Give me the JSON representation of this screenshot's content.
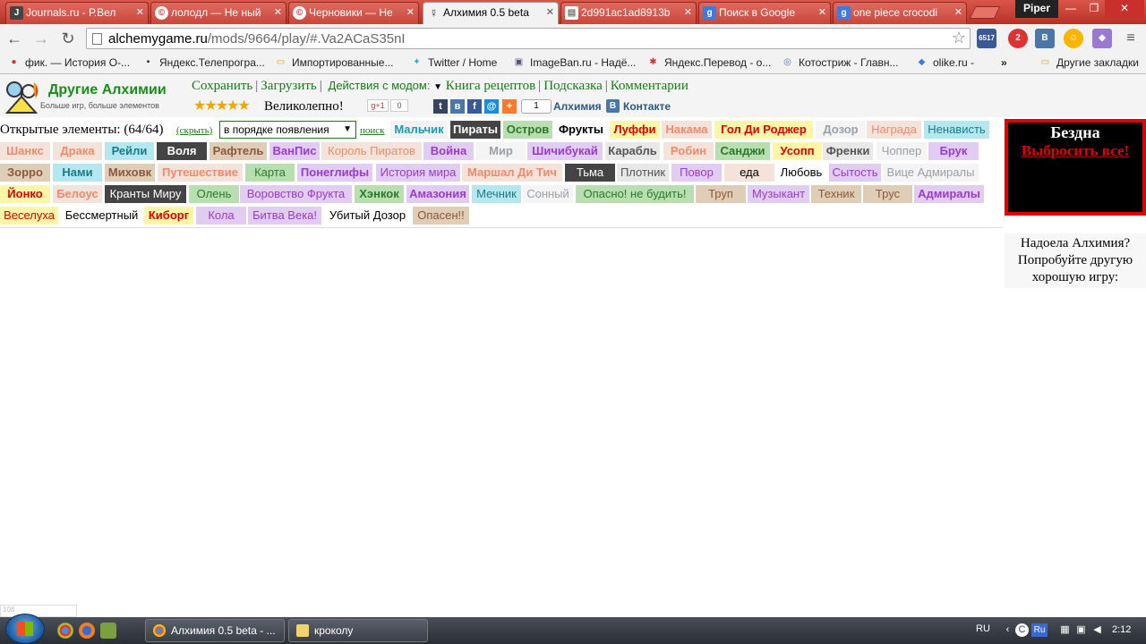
{
  "browser": {
    "tabs": [
      {
        "title": "Journals.ru - Р.Вел",
        "icon": "J",
        "active": false
      },
      {
        "title": "лолодл — Не ный",
        "icon": "©",
        "active": false
      },
      {
        "title": "Черновики — Не",
        "icon": "©",
        "active": false
      },
      {
        "title": "Алхимия 0.5 beta",
        "icon": "☿",
        "active": true
      },
      {
        "title": "2d991ac1ad8913b",
        "icon": "▤",
        "active": false
      },
      {
        "title": "Поиск в Google",
        "icon": "g",
        "active": false
      },
      {
        "title": "one piece crocodi",
        "icon": "g",
        "active": false
      }
    ],
    "profile": "Piper",
    "url_host": "alchemygame.ru",
    "url_path": "/mods/9664/play/#.Va2ACaS35nI",
    "extensions": {
      "counter": "6517",
      "badge": "2"
    },
    "bookmarks": [
      {
        "label": "фик. — История О-...",
        "icon": "●"
      },
      {
        "label": "Яндекс.Телепрогра...",
        "icon": "▪"
      },
      {
        "label": "Импортированные...",
        "icon": "▭"
      },
      {
        "label": "Twitter / Home",
        "icon": "✦"
      },
      {
        "label": "ImageBan.ru - Надё...",
        "icon": "▣"
      },
      {
        "label": "Яндекс.Перевод - о...",
        "icon": "✱"
      },
      {
        "label": "Котостриж - Главн...",
        "icon": "◎"
      },
      {
        "label": "olike.ru -",
        "icon": "◆"
      }
    ],
    "bookmarks_more": "»",
    "bookmarks_other": "Другие закладки"
  },
  "site": {
    "title": "Другие Алхимии",
    "subtitle": "Больше игр, больше элементов",
    "menu": {
      "save": "Сохранить",
      "load": "Загрузить",
      "actions": "Действия с модом:",
      "recipes": "Книга рецептов",
      "hint": "Подсказка",
      "comments": "Комментарии"
    },
    "rating_text": "Великолепно!",
    "gplus": "g+1",
    "gplus_count": "0",
    "vk_count": "1",
    "alchemy_link": "Алхимия",
    "vk_link": "Контакте"
  },
  "elements_panel": {
    "opened_label": "Открытые элементы: (64/64)",
    "hide_link": "(скрыть)",
    "sort_value": "в порядке появления",
    "search_link": "поиск"
  },
  "elements": [
    {
      "label": "Мальчик",
      "bg": "#f2f2f2",
      "fg": "#1a9bb0",
      "bold": true
    },
    {
      "label": "Пираты",
      "bg": "#444444",
      "fg": "#ffffff",
      "bold": true
    },
    {
      "label": "Остров",
      "bg": "#b9dfb0",
      "fg": "#2a7a2a",
      "bold": true
    },
    {
      "label": "Фрукты",
      "bg": "#ffffff",
      "fg": "#000000",
      "bold": true
    },
    {
      "label": "Луффи",
      "bg": "#fff6a8",
      "fg": "#e00000",
      "bold": true
    },
    {
      "label": "Накама",
      "bg": "#f4e3db",
      "fg": "#f08a6a",
      "bold": true
    },
    {
      "label": "Гол Ди Роджер",
      "bg": "#fff6a8",
      "fg": "#e00000",
      "bold": true
    },
    {
      "label": "Дозор",
      "bg": "#f4f4f4",
      "fg": "#9aa0a6",
      "bold": true
    },
    {
      "label": "Награда",
      "bg": "#f4e3db",
      "fg": "#f08a6a",
      "bold": false
    },
    {
      "label": "Ненависть",
      "bg": "#b5e8ee",
      "fg": "#1a7a8a",
      "bold": false
    },
    {
      "label": "Шанкс",
      "bg": "#f4e3db",
      "fg": "#f08a6a",
      "bold": true
    },
    {
      "label": "Драка",
      "bg": "#f4e3db",
      "fg": "#f08a6a",
      "bold": true
    },
    {
      "label": "Рейли",
      "bg": "#b5e8ee",
      "fg": "#1a7a8a",
      "bold": true
    },
    {
      "label": "Воля",
      "bg": "#444444",
      "fg": "#ffffff",
      "bold": true
    },
    {
      "label": "Рафтель",
      "bg": "#e0cdb8",
      "fg": "#8a5a3a",
      "bold": true
    },
    {
      "label": "ВанПис",
      "bg": "#e2cdf2",
      "fg": "#9a3ad0",
      "bold": true
    },
    {
      "label": "Король Пиратов",
      "bg": "#f4e3db",
      "fg": "#f08a6a",
      "bold": false
    },
    {
      "label": "Война",
      "bg": "#e2cdf2",
      "fg": "#9a3ad0",
      "bold": true
    },
    {
      "label": "Мир",
      "bg": "#f4f4f4",
      "fg": "#9aa0a6",
      "bold": true
    },
    {
      "label": "Шичибукай",
      "bg": "#e2cdf2",
      "fg": "#9a3ad0",
      "bold": true
    },
    {
      "label": "Карабль",
      "bg": "#e8e8e8",
      "fg": "#555555",
      "bold": true
    },
    {
      "label": "Робин",
      "bg": "#f4e3db",
      "fg": "#f08a6a",
      "bold": true
    },
    {
      "label": "Санджи",
      "bg": "#b9dfb0",
      "fg": "#2a7a2a",
      "bold": true
    },
    {
      "label": "Усопп",
      "bg": "#fff6a8",
      "fg": "#e00000",
      "bold": true
    },
    {
      "label": "Френки",
      "bg": "#e8e8e8",
      "fg": "#555555",
      "bold": true
    },
    {
      "label": "Чоппер",
      "bg": "#f4f4f4",
      "fg": "#9aa0a6",
      "bold": false
    },
    {
      "label": "Брук",
      "bg": "#e2cdf2",
      "fg": "#9a3ad0",
      "bold": true
    },
    {
      "label": "Зорро",
      "bg": "#e0cdb8",
      "fg": "#8a5a3a",
      "bold": true
    },
    {
      "label": "Нами",
      "bg": "#b5e8ee",
      "fg": "#1a7a8a",
      "bold": true
    },
    {
      "label": "Миховк",
      "bg": "#e0cdb8",
      "fg": "#8a5a3a",
      "bold": true
    },
    {
      "label": "Путешествие",
      "bg": "#f4e3db",
      "fg": "#f08a6a",
      "bold": true
    },
    {
      "label": "Карта",
      "bg": "#b9dfb0",
      "fg": "#2a7a2a",
      "bold": false
    },
    {
      "label": "Понеглифы",
      "bg": "#e2cdf2",
      "fg": "#9a3ad0",
      "bold": true
    },
    {
      "label": "История мира",
      "bg": "#e2cdf2",
      "fg": "#9a3ad0",
      "bold": false
    },
    {
      "label": "Маршал Ди Тич",
      "bg": "#f4e3db",
      "fg": "#f08a6a",
      "bold": true
    },
    {
      "label": "Тьма",
      "bg": "#444444",
      "fg": "#ffffff",
      "bold": false
    },
    {
      "label": "Плотник",
      "bg": "#e8e8e8",
      "fg": "#555555",
      "bold": false
    },
    {
      "label": "Повор",
      "bg": "#e2cdf2",
      "fg": "#9a3ad0",
      "bold": false
    },
    {
      "label": "еда",
      "bg": "#f4e3db",
      "fg": "#000000",
      "bold": false
    },
    {
      "label": "Любовь",
      "bg": "#ffffff",
      "fg": "#000000",
      "bold": false
    },
    {
      "label": "Сытость",
      "bg": "#e2cdf2",
      "fg": "#9a3ad0",
      "bold": false
    },
    {
      "label": "Вице Адмиралы",
      "bg": "#f4f4f4",
      "fg": "#9aa0a6",
      "bold": false
    },
    {
      "label": "Йонко",
      "bg": "#fff6a8",
      "fg": "#e00000",
      "bold": true
    },
    {
      "label": "Белоус",
      "bg": "#f4e3db",
      "fg": "#f08a6a",
      "bold": true
    },
    {
      "label": "Кранты Миру",
      "bg": "#444444",
      "fg": "#ffffff",
      "bold": false
    },
    {
      "label": "Олень",
      "bg": "#b9dfb0",
      "fg": "#2a7a2a",
      "bold": false
    },
    {
      "label": "Воровство Фрукта",
      "bg": "#e2cdf2",
      "fg": "#9a3ad0",
      "bold": false
    },
    {
      "label": "Хэнкок",
      "bg": "#b9dfb0",
      "fg": "#2a7a2a",
      "bold": true
    },
    {
      "label": "Амазония",
      "bg": "#e2cdf2",
      "fg": "#9a3ad0",
      "bold": true
    },
    {
      "label": "Мечник",
      "bg": "#b5e8ee",
      "fg": "#1a7a8a",
      "bold": false
    },
    {
      "label": "Сонный",
      "bg": "#f4f4f4",
      "fg": "#9aa0a6",
      "bold": false
    },
    {
      "label": "Опасно! не будить!",
      "bg": "#b9dfb0",
      "fg": "#2a7a2a",
      "bold": false
    },
    {
      "label": "Труп",
      "bg": "#e0cdb8",
      "fg": "#8a5a3a",
      "bold": false
    },
    {
      "label": "Музыкант",
      "bg": "#e2cdf2",
      "fg": "#9a3ad0",
      "bold": false
    },
    {
      "label": "Техник",
      "bg": "#e0cdb8",
      "fg": "#8a5a3a",
      "bold": false
    },
    {
      "label": "Трус",
      "bg": "#e0cdb8",
      "fg": "#8a5a3a",
      "bold": false
    },
    {
      "label": "Адмиралы",
      "bg": "#e2cdf2",
      "fg": "#9a3ad0",
      "bold": true
    },
    {
      "label": "Веселуха",
      "bg": "#fff6a8",
      "fg": "#e00000",
      "bold": false
    },
    {
      "label": "Бессмертный",
      "bg": "#ffffff",
      "fg": "#000000",
      "bold": false
    },
    {
      "label": "Киборг",
      "bg": "#fff6a8",
      "fg": "#e00000",
      "bold": true
    },
    {
      "label": "Кола",
      "bg": "#e2cdf2",
      "fg": "#9a3ad0",
      "bold": false
    },
    {
      "label": "Битва Века!",
      "bg": "#e2cdf2",
      "fg": "#9a3ad0",
      "bold": false
    },
    {
      "label": "Убитый Дозор",
      "bg": "#ffffff",
      "fg": "#000000",
      "bold": false
    },
    {
      "label": "Опасен!!",
      "bg": "#e0cdb8",
      "fg": "#8a5a3a",
      "bold": false
    }
  ],
  "abyss": {
    "title": "Бездна",
    "button": "Выбросить все!"
  },
  "other_game": "Надоела Алхимия? Попробуйте другую хорошую игру:",
  "corner_text": "108",
  "taskbar": {
    "tasks": [
      {
        "title": "Алхимия 0.5 beta - ..."
      },
      {
        "title": "кроколу"
      }
    ],
    "lang": "RU",
    "tray_lang": "Ru",
    "clock": "2:12"
  }
}
